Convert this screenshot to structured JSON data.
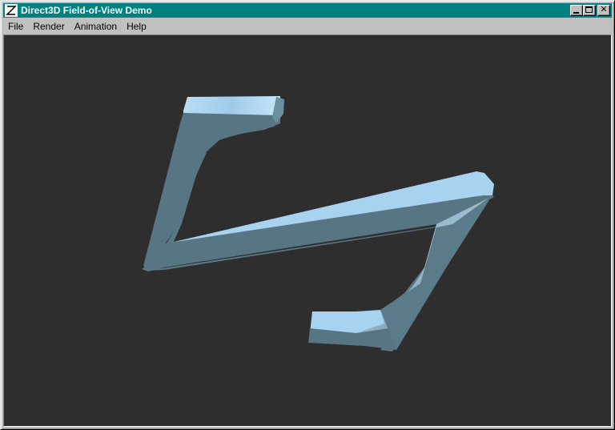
{
  "window": {
    "title": "Direct3D Field-of-View Demo",
    "title_bar_color": "#008080",
    "icon": "app-logo-icon"
  },
  "title_buttons": {
    "minimize": "minimize-icon",
    "maximize": "maximize-icon",
    "close": "close-icon",
    "close_glyph": "✕"
  },
  "menu": {
    "items": [
      "File",
      "Render",
      "Animation",
      "Help"
    ]
  },
  "viewport": {
    "background": "#2e2e2e",
    "object": "3D rendered shape",
    "object_color": "#587584",
    "highlight_color": "#a8d3f0"
  }
}
